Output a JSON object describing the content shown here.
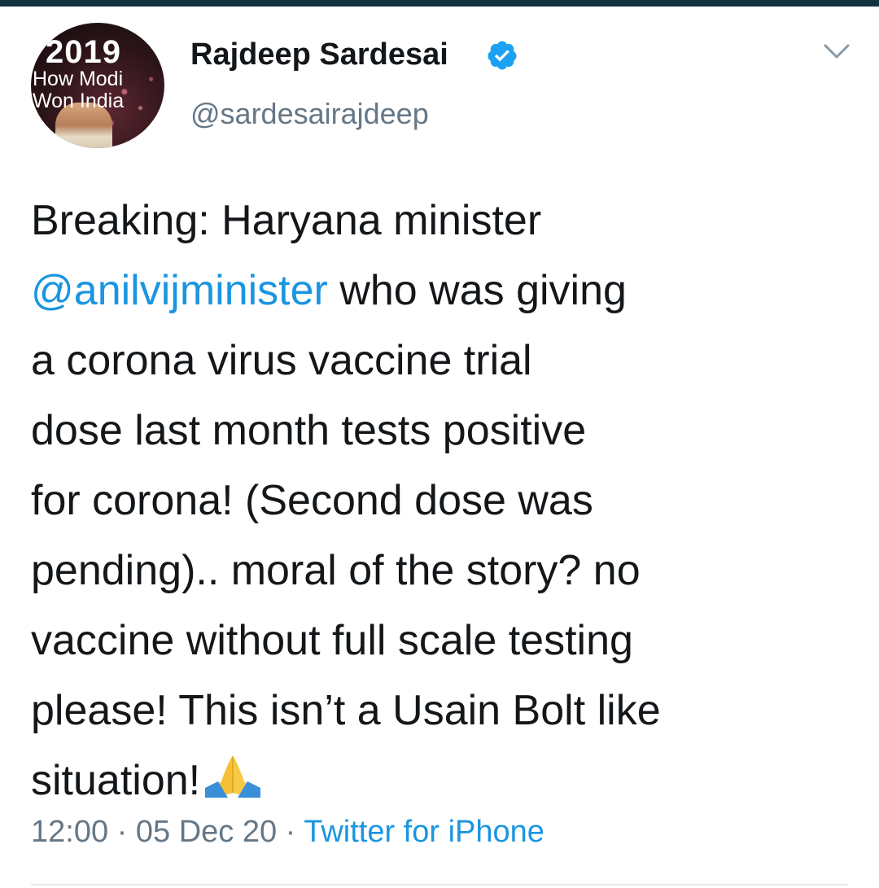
{
  "profile": {
    "avatar_lines": [
      "2019",
      "How Modi",
      "Won India"
    ],
    "display_name": "Rajdeep Sardesai",
    "handle": "@sardesairajdeep",
    "verified_icon": "verified-badge-icon"
  },
  "menu": {
    "icon": "chevron-down-icon"
  },
  "tweet": {
    "lines": [
      "Breaking: Haryana minister",
      " who was giving",
      "a corona virus vaccine trial",
      "dose last month tests positive",
      "for corona! (Second dose was",
      "pending).. moral of the story? no",
      "vaccine without full scale testing",
      "please! This isn’t a Usain Bolt like",
      "situation!"
    ],
    "mention": "@anilvijminister",
    "emoji": "folded-hands-icon"
  },
  "meta": {
    "time": "12:00",
    "separator": " · ",
    "date": "05 Dec 20",
    "source": "Twitter for iPhone"
  },
  "colors": {
    "link": "#1b95e0",
    "secondary_text": "#657786",
    "primary_text": "#14171a",
    "top_strip": "#14313f"
  }
}
